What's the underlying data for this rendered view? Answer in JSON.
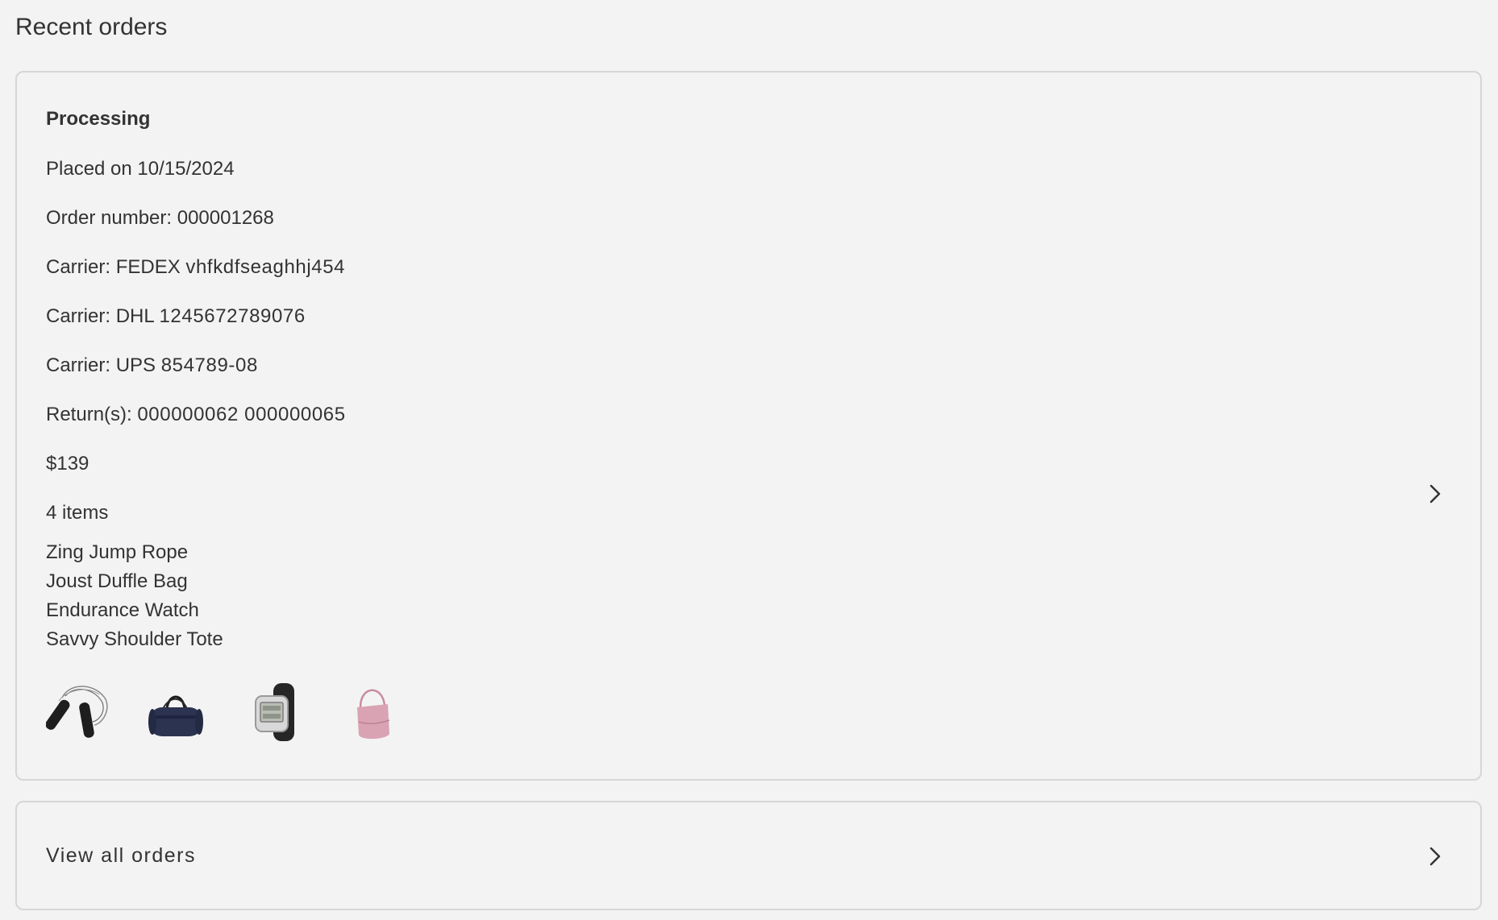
{
  "page": {
    "title": "Recent orders"
  },
  "order": {
    "status": "Processing",
    "placed_label": "Placed on",
    "placed_date": "10/15/2024",
    "order_number_label": "Order number:",
    "order_number": "000001268",
    "carriers": [
      {
        "label": "Carrier:",
        "name": "FEDEX",
        "tracking": "vhfkdfseaghhj454"
      },
      {
        "label": "Carrier:",
        "name": "DHL",
        "tracking": "1245672789076"
      },
      {
        "label": "Carrier:",
        "name": "UPS",
        "tracking": "854789-08"
      }
    ],
    "returns_label": "Return(s):",
    "returns": "000000062 000000065",
    "total": "$139",
    "item_count": "4 items",
    "items": [
      {
        "name": "Zing Jump Rope",
        "icon": "jump-rope-image"
      },
      {
        "name": "Joust Duffle Bag",
        "icon": "duffle-bag-image"
      },
      {
        "name": "Endurance Watch",
        "icon": "watch-image"
      },
      {
        "name": "Savvy Shoulder Tote",
        "icon": "shoulder-tote-image"
      }
    ],
    "chevron_icon": "chevron-right-icon"
  },
  "view_all": {
    "label": "View all orders",
    "chevron_icon": "chevron-right-icon"
  },
  "colors": {
    "background": "#f3f3f3",
    "border": "#d6d6d6",
    "text": "#333333"
  }
}
